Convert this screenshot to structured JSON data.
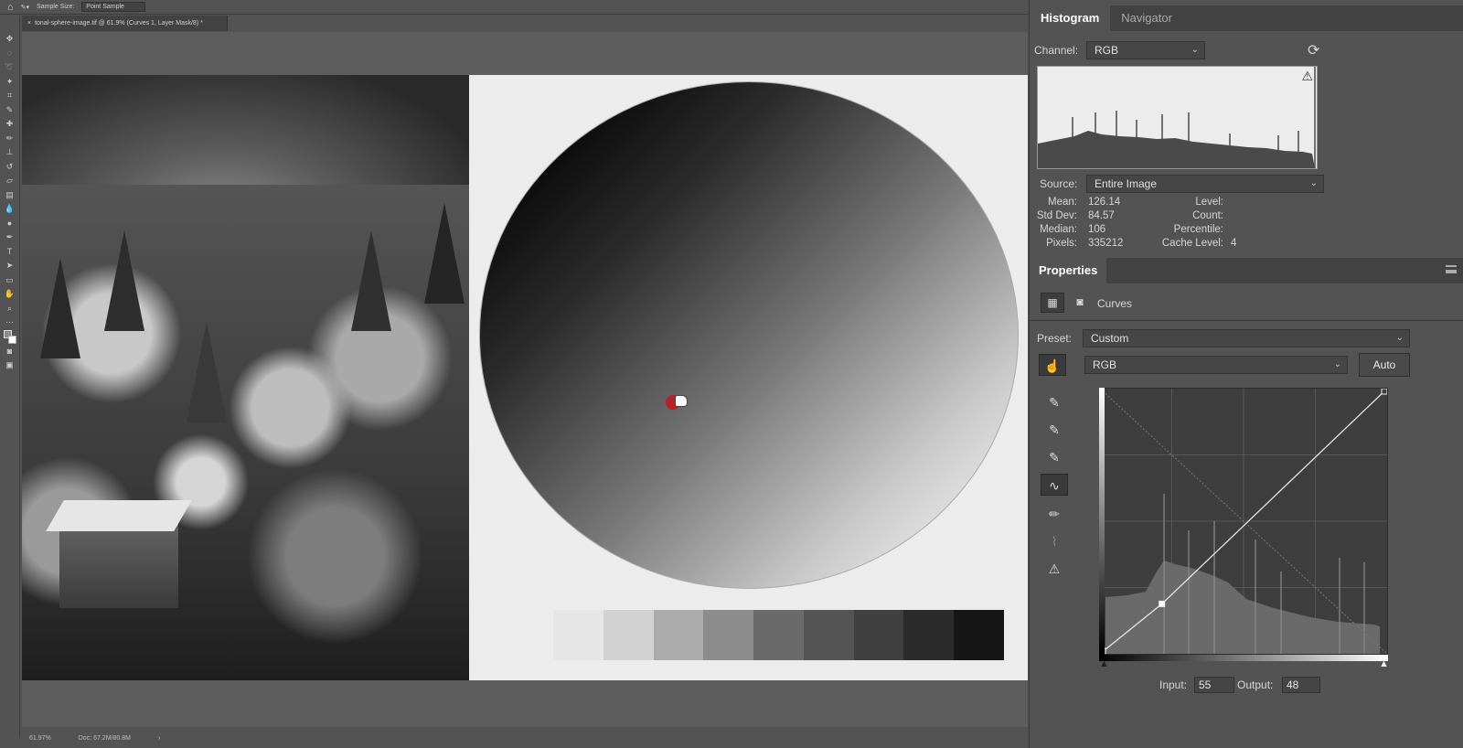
{
  "options_bar": {
    "sample_size_label": "Sample Size:",
    "sample_size_value": "Point Sample"
  },
  "document": {
    "tab_title": "tonal-sphere-image.tif @ 61.9% (Curves 1, Layer Mask/8) *",
    "close_glyph": "×"
  },
  "status_bar": {
    "zoom": "61.97%",
    "doc_info": "Doc: 67.2M/80.8M"
  },
  "tonal_steps": [
    "#e6e6e6",
    "#d2d2d2",
    "#ababab",
    "#8c8c8c",
    "#6a6a6a",
    "#545454",
    "#404040",
    "#2b2b2b",
    "#161616"
  ],
  "histogram_panel": {
    "tabs": [
      "Histogram",
      "Navigator"
    ],
    "channel_label": "Channel:",
    "channel_value": "RGB",
    "source_label": "Source:",
    "source_value": "Entire Image",
    "stats_left": [
      {
        "label": "Mean:",
        "value": "126.14"
      },
      {
        "label": "Std Dev:",
        "value": "84.57"
      },
      {
        "label": "Median:",
        "value": "106"
      },
      {
        "label": "Pixels:",
        "value": "335212"
      }
    ],
    "stats_right": [
      {
        "label": "Level:",
        "value": ""
      },
      {
        "label": "Count:",
        "value": ""
      },
      {
        "label": "Percentile:",
        "value": ""
      },
      {
        "label": "Cache Level:",
        "value": "4"
      }
    ],
    "warning_icon": "warning-icon",
    "refresh_icon": "refresh-icon"
  },
  "properties_panel": {
    "title": "Properties",
    "adjustment_name": "Curves",
    "preset_label": "Preset:",
    "preset_value": "Custom",
    "channel_value": "RGB",
    "auto_label": "Auto",
    "input_label": "Input:",
    "input_value": "55",
    "output_label": "Output:",
    "output_value": "48"
  },
  "curve": {
    "points": [
      [
        0,
        0
      ],
      [
        55,
        48
      ],
      [
        255,
        255
      ]
    ]
  }
}
